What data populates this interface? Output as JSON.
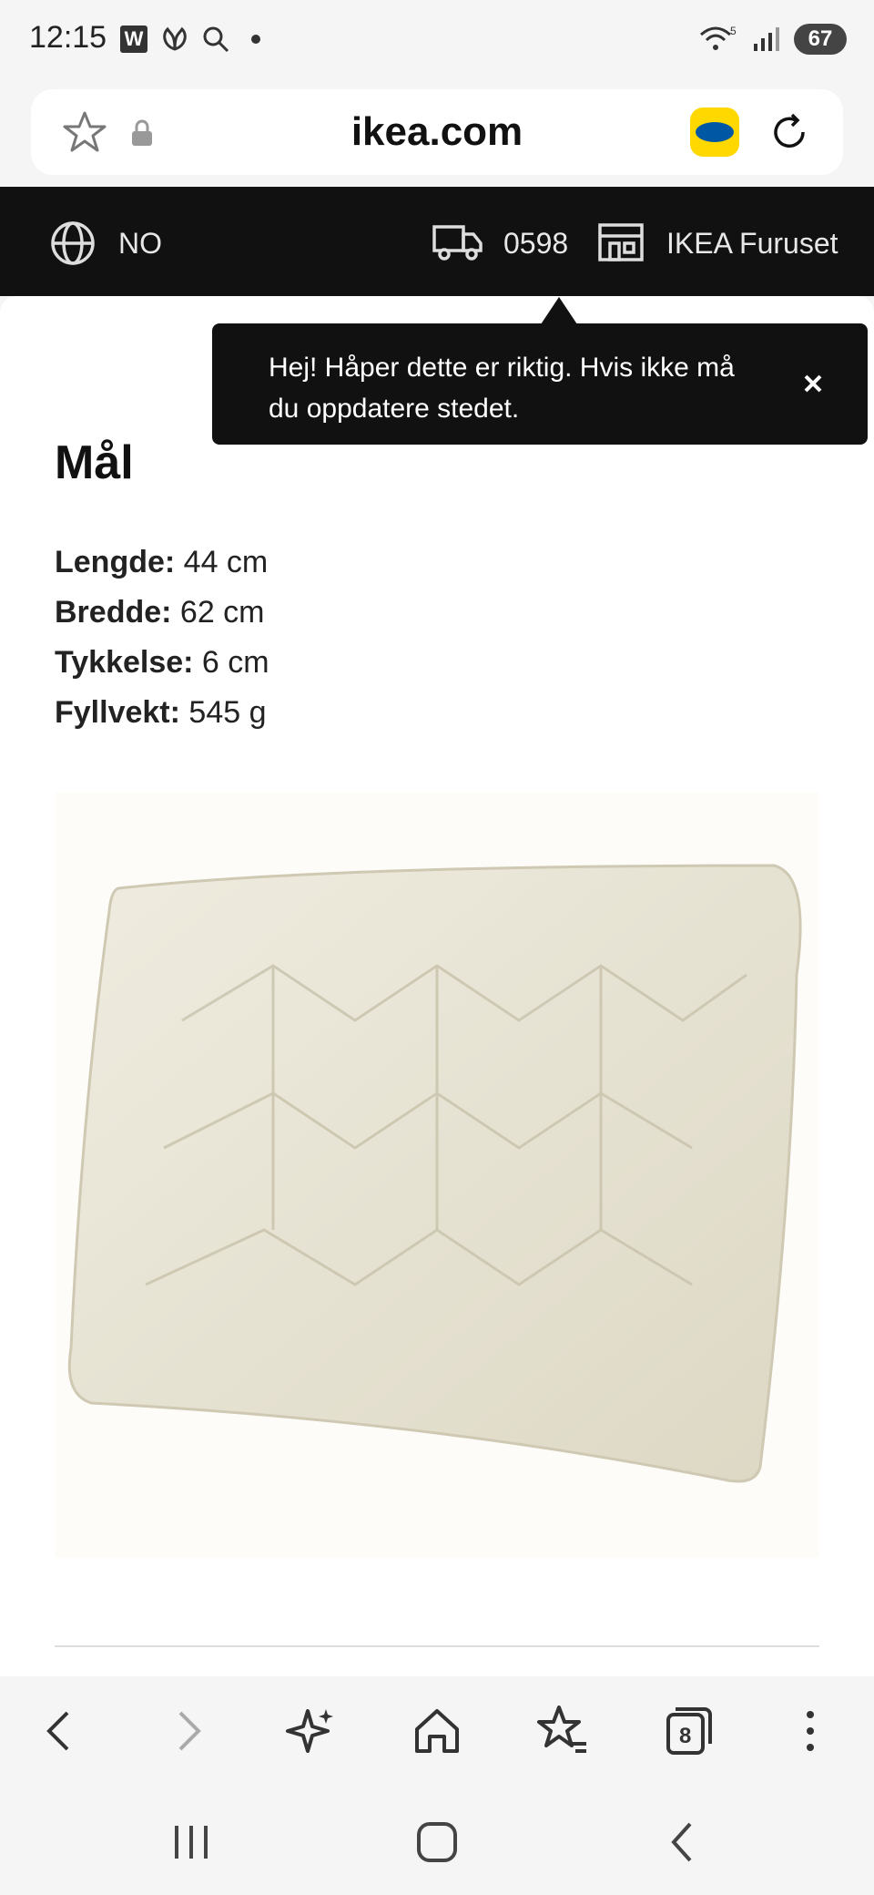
{
  "status_bar": {
    "time": "12:15",
    "app_badge": "W",
    "battery": "67",
    "wifi_label": "5"
  },
  "browser": {
    "url": "ikea.com"
  },
  "location_bar": {
    "language": "NO",
    "postal_code": "0598",
    "store": "IKEA Furuset"
  },
  "tooltip": {
    "message": "Hej! Håper dette er riktig. Hvis ikke må du oppdatere stedet."
  },
  "section": {
    "title": "Mål",
    "dimensions": [
      {
        "label": "Lengde:",
        "value": "44 cm"
      },
      {
        "label": "Bredde:",
        "value": "62 cm"
      },
      {
        "label": "Tykkelse:",
        "value": "6 cm"
      },
      {
        "label": "Fyllvekt:",
        "value": "545 g"
      }
    ]
  },
  "bottom_nav": {
    "tab_count": "8"
  },
  "colors": {
    "accent_black": "#111111",
    "ikea_yellow": "#ffd800",
    "ikea_blue": "#0057a3",
    "cushion": "#e7e3d3"
  }
}
